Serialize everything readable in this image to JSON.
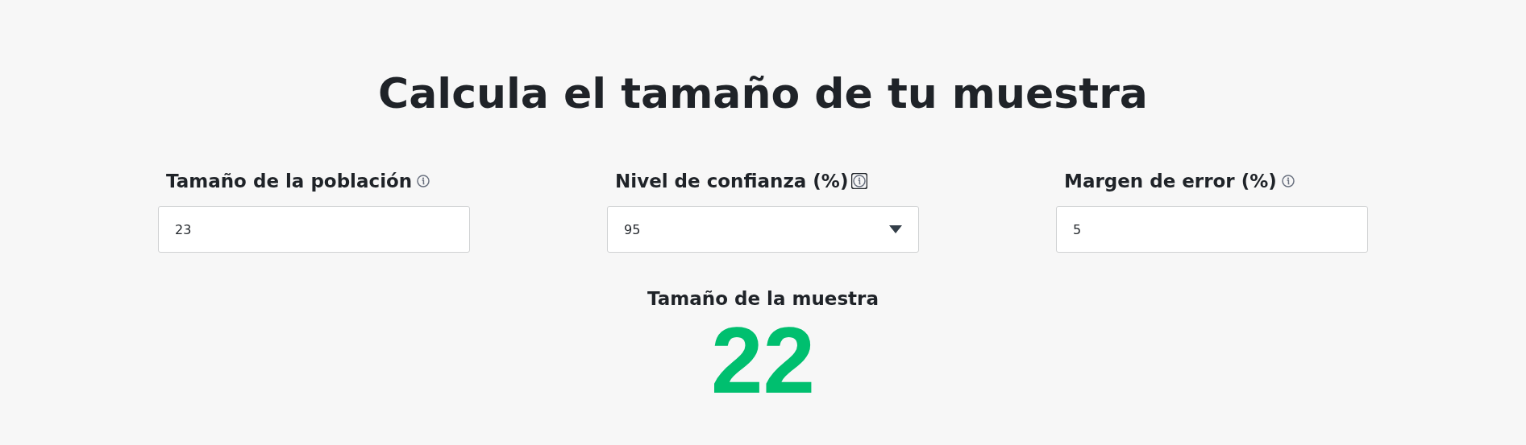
{
  "title": "Calcula el tamaño de tu muestra",
  "fields": [
    {
      "kind": "input",
      "label": "Tamaño de la población",
      "value": "23",
      "info_focused": false
    },
    {
      "kind": "select",
      "label": "Nivel de confianza (%)",
      "value": "95",
      "info_focused": true
    },
    {
      "kind": "input",
      "label": "Margen de error (%)",
      "value": "5",
      "info_focused": false
    }
  ],
  "result": {
    "label": "Tamaño de la muestra",
    "value": "22"
  }
}
